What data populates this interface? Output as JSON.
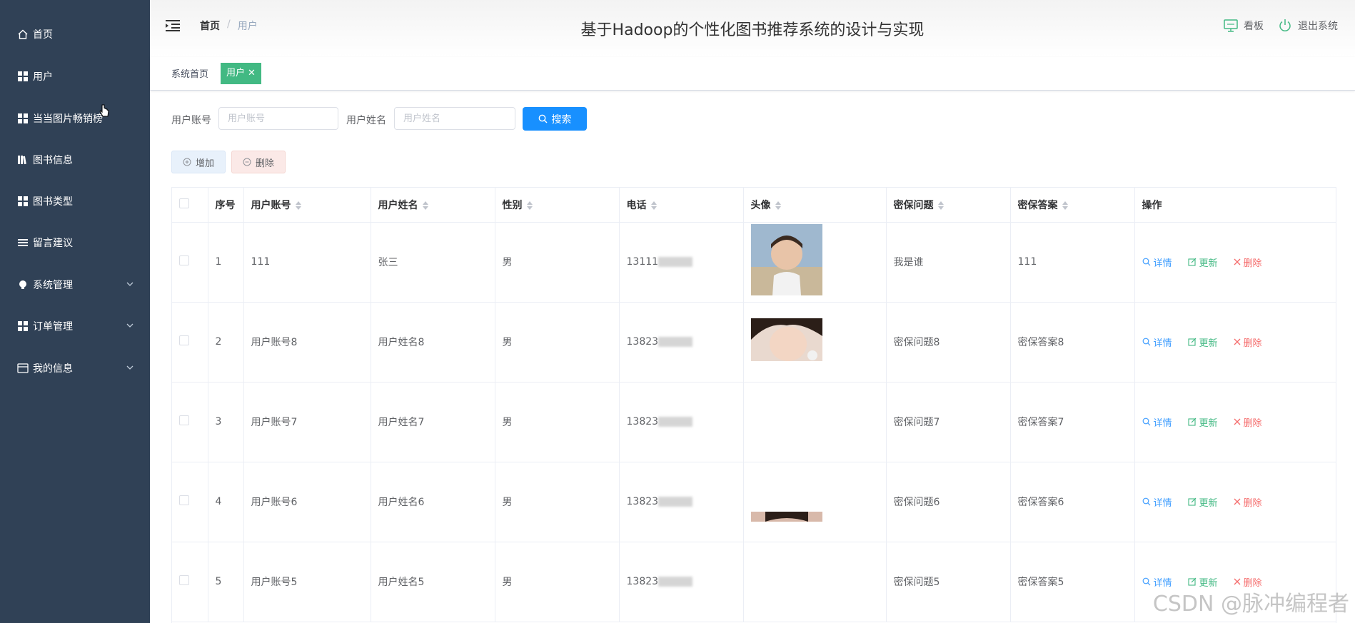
{
  "sidebar": {
    "items": [
      {
        "label": "首页",
        "icon": "home-icon"
      },
      {
        "label": "用户",
        "icon": "grid-icon"
      },
      {
        "label": "当当图片畅销榜",
        "icon": "grid-icon"
      },
      {
        "label": "图书信息",
        "icon": "books-icon"
      },
      {
        "label": "图书类型",
        "icon": "grid-icon"
      },
      {
        "label": "留言建议",
        "icon": "list-icon"
      },
      {
        "label": "系统管理",
        "icon": "bulb-icon",
        "expandable": true
      },
      {
        "label": "订单管理",
        "icon": "grid-icon",
        "expandable": true
      },
      {
        "label": "我的信息",
        "icon": "card-icon",
        "expandable": true
      }
    ]
  },
  "header": {
    "breadcrumb": {
      "home": "首页",
      "separator": "/",
      "current": "用户"
    },
    "title": "基于Hadoop的个性化图书推荐系统的设计与实现",
    "dashboard_label": "看板",
    "logout_label": "退出系统"
  },
  "tags": {
    "home": "系统首页",
    "active": "用户"
  },
  "search": {
    "account_label": "用户账号",
    "account_placeholder": "用户账号",
    "name_label": "用户姓名",
    "name_placeholder": "用户姓名",
    "button_label": "搜索"
  },
  "actions": {
    "add_label": "增加",
    "delete_label": "删除"
  },
  "table": {
    "headers": [
      "序号",
      "用户账号",
      "用户姓名",
      "性别",
      "电话",
      "头像",
      "密保问题",
      "密保答案",
      "操作"
    ],
    "row_actions": {
      "detail": "详情",
      "update": "更新",
      "delete": "删除"
    },
    "rows": [
      {
        "index": "1",
        "account": "111",
        "name": "张三",
        "gender": "男",
        "phone": "13111",
        "question": "我是谁",
        "answer": "111",
        "avatar": "boy"
      },
      {
        "index": "2",
        "account": "用户账号8",
        "name": "用户姓名8",
        "gender": "男",
        "phone": "13823",
        "question": "密保问题8",
        "answer": "密保答案8",
        "avatar": "girl"
      },
      {
        "index": "3",
        "account": "用户账号7",
        "name": "用户姓名7",
        "gender": "男",
        "phone": "13823",
        "question": "密保问题7",
        "answer": "密保答案7",
        "avatar": "none"
      },
      {
        "index": "4",
        "account": "用户账号6",
        "name": "用户姓名6",
        "gender": "男",
        "phone": "13823",
        "question": "密保问题6",
        "answer": "密保答案6",
        "avatar": "none"
      },
      {
        "index": "5",
        "account": "用户账号5",
        "name": "用户姓名5",
        "gender": "男",
        "phone": "13823",
        "question": "密保问题5",
        "answer": "密保答案5",
        "avatar": "partial"
      }
    ]
  },
  "watermark": "CSDN @脉冲编程者",
  "colors": {
    "sidebar_bg": "#304156",
    "accent_green": "#42b983",
    "primary_blue": "#1890ff",
    "danger_red": "#f56c6c"
  }
}
